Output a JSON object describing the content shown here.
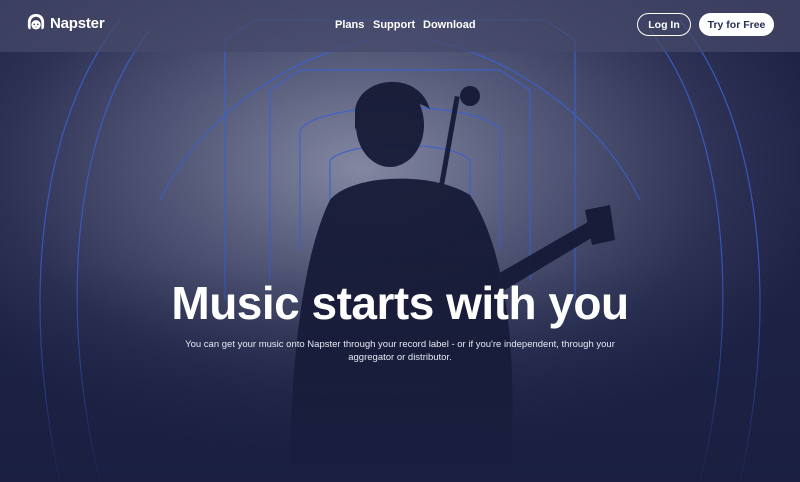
{
  "header": {
    "brand": "Napster",
    "logo_icon": "napster-headphones-cat-icon",
    "nav": [
      {
        "label": "Plans"
      },
      {
        "label": "Support"
      },
      {
        "label": "Download"
      }
    ],
    "login_label": "Log In",
    "try_label": "Try for Free"
  },
  "hero": {
    "title": "Music starts with you",
    "subtitle": "You can get your music onto Napster through your record label - or if you're independent, through your aggregator or distributor."
  },
  "colors": {
    "background": "#1c2142",
    "topbar": "#464a69",
    "accent_lines": "#3b63d8",
    "button_text": "#2a2f55"
  }
}
